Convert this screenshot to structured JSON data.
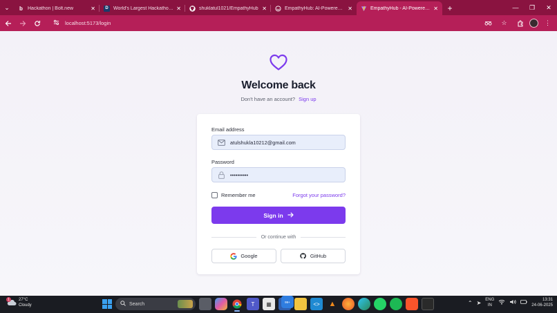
{
  "browser": {
    "tabs": [
      {
        "favicon": "b",
        "title": "Hackathon | Bolt.new",
        "active": false
      },
      {
        "favicon": "D",
        "title": "World's Largest Hackathon pre",
        "active": false
      },
      {
        "favicon": "github-icon",
        "title": "shuklatul1021/EmpathyHub",
        "active": false
      },
      {
        "favicon": "globe-icon",
        "title": "EmpathyHub: AI-Powered Peer",
        "active": false
      },
      {
        "favicon": "vite-icon",
        "title": "EmpathyHub - AI-Powered Pee",
        "active": true
      }
    ],
    "new_tab": "+",
    "url": "localhost:5173/login",
    "window_controls": {
      "minimize": "—",
      "restore": "❐",
      "close": "✕"
    }
  },
  "login": {
    "title": "Welcome back",
    "subtitle": "Don't have an account?",
    "signup_link": "Sign up",
    "email_label": "Email address",
    "email_value": "atulshukla10212@gmail.com",
    "password_label": "Password",
    "password_value": "••••••••••",
    "remember_label": "Remember me",
    "forgot_link": "Forgot your password?",
    "signin_label": "Sign in",
    "divider_text": "Or continue with",
    "google_label": "Google",
    "github_label": "GitHub",
    "accent_color": "#7c3aed"
  },
  "taskbar": {
    "weather_badge": "1",
    "temperature": "27°C",
    "condition": "Cloudy",
    "search_placeholder": "Search",
    "notification_badge": "99+",
    "language_line1": "ENG",
    "language_line2": "IN",
    "time": "13:31",
    "date": "24-06-2025"
  }
}
